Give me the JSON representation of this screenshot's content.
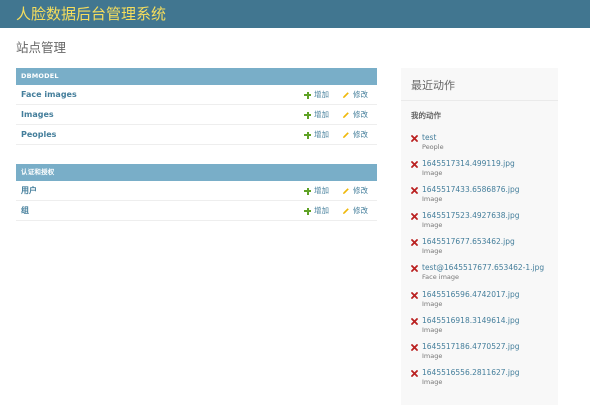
{
  "header": {
    "brand": "人脸数据后台管理系统"
  },
  "page": {
    "title": "站点管理"
  },
  "modules": [
    {
      "caption": "DBMODEL",
      "rows": [
        {
          "name": "Face images",
          "add": "增加",
          "change": "修改"
        },
        {
          "name": "Images",
          "add": "增加",
          "change": "修改"
        },
        {
          "name": "Peoples",
          "add": "增加",
          "change": "修改"
        }
      ]
    },
    {
      "caption": "认证和授权",
      "rows": [
        {
          "name": "用户",
          "add": "增加",
          "change": "修改"
        },
        {
          "name": "组",
          "add": "增加",
          "change": "修改"
        }
      ]
    }
  ],
  "sidebar": {
    "title": "最近动作",
    "subtitle": "我的动作",
    "actions": [
      {
        "name": "test",
        "type": "People",
        "icon": "delete-icon"
      },
      {
        "name": "1645517314.499119.jpg",
        "type": "Image",
        "icon": "delete-icon"
      },
      {
        "name": "1645517433.6586876.jpg",
        "type": "Image",
        "icon": "delete-icon"
      },
      {
        "name": "1645517523.4927638.jpg",
        "type": "Image",
        "icon": "delete-icon"
      },
      {
        "name": "1645517677.653462.jpg",
        "type": "Image",
        "icon": "delete-icon"
      },
      {
        "name": "test@1645517677.653462-1.jpg",
        "type": "Face image",
        "icon": "delete-icon"
      },
      {
        "name": "1645516596.4742017.jpg",
        "type": "Image",
        "icon": "delete-icon"
      },
      {
        "name": "1645516918.3149614.jpg",
        "type": "Image",
        "icon": "delete-icon"
      },
      {
        "name": "1645517186.4770527.jpg",
        "type": "Image",
        "icon": "delete-icon"
      },
      {
        "name": "1645516556.2811627.jpg",
        "type": "Image",
        "icon": "delete-icon"
      }
    ]
  },
  "colors": {
    "header_bg": "#417690",
    "brand_text": "#f5dd5d",
    "module_caption_bg": "#79aec8",
    "link": "#447e9b",
    "add_icon": "#5fa225",
    "change_icon": "#efb80b",
    "delete_icon": "#ba2121"
  }
}
